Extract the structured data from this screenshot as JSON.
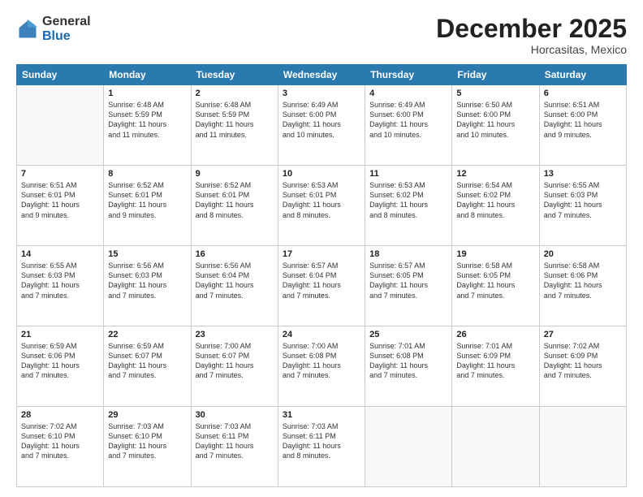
{
  "header": {
    "logo_general": "General",
    "logo_blue": "Blue",
    "month_title": "December 2025",
    "location": "Horcasitas, Mexico"
  },
  "days_of_week": [
    "Sunday",
    "Monday",
    "Tuesday",
    "Wednesday",
    "Thursday",
    "Friday",
    "Saturday"
  ],
  "weeks": [
    [
      {
        "day": "",
        "info": ""
      },
      {
        "day": "1",
        "info": "Sunrise: 6:48 AM\nSunset: 5:59 PM\nDaylight: 11 hours\nand 11 minutes."
      },
      {
        "day": "2",
        "info": "Sunrise: 6:48 AM\nSunset: 5:59 PM\nDaylight: 11 hours\nand 11 minutes."
      },
      {
        "day": "3",
        "info": "Sunrise: 6:49 AM\nSunset: 6:00 PM\nDaylight: 11 hours\nand 10 minutes."
      },
      {
        "day": "4",
        "info": "Sunrise: 6:49 AM\nSunset: 6:00 PM\nDaylight: 11 hours\nand 10 minutes."
      },
      {
        "day": "5",
        "info": "Sunrise: 6:50 AM\nSunset: 6:00 PM\nDaylight: 11 hours\nand 10 minutes."
      },
      {
        "day": "6",
        "info": "Sunrise: 6:51 AM\nSunset: 6:00 PM\nDaylight: 11 hours\nand 9 minutes."
      }
    ],
    [
      {
        "day": "7",
        "info": "Sunrise: 6:51 AM\nSunset: 6:01 PM\nDaylight: 11 hours\nand 9 minutes."
      },
      {
        "day": "8",
        "info": "Sunrise: 6:52 AM\nSunset: 6:01 PM\nDaylight: 11 hours\nand 9 minutes."
      },
      {
        "day": "9",
        "info": "Sunrise: 6:52 AM\nSunset: 6:01 PM\nDaylight: 11 hours\nand 8 minutes."
      },
      {
        "day": "10",
        "info": "Sunrise: 6:53 AM\nSunset: 6:01 PM\nDaylight: 11 hours\nand 8 minutes."
      },
      {
        "day": "11",
        "info": "Sunrise: 6:53 AM\nSunset: 6:02 PM\nDaylight: 11 hours\nand 8 minutes."
      },
      {
        "day": "12",
        "info": "Sunrise: 6:54 AM\nSunset: 6:02 PM\nDaylight: 11 hours\nand 8 minutes."
      },
      {
        "day": "13",
        "info": "Sunrise: 6:55 AM\nSunset: 6:03 PM\nDaylight: 11 hours\nand 7 minutes."
      }
    ],
    [
      {
        "day": "14",
        "info": "Sunrise: 6:55 AM\nSunset: 6:03 PM\nDaylight: 11 hours\nand 7 minutes."
      },
      {
        "day": "15",
        "info": "Sunrise: 6:56 AM\nSunset: 6:03 PM\nDaylight: 11 hours\nand 7 minutes."
      },
      {
        "day": "16",
        "info": "Sunrise: 6:56 AM\nSunset: 6:04 PM\nDaylight: 11 hours\nand 7 minutes."
      },
      {
        "day": "17",
        "info": "Sunrise: 6:57 AM\nSunset: 6:04 PM\nDaylight: 11 hours\nand 7 minutes."
      },
      {
        "day": "18",
        "info": "Sunrise: 6:57 AM\nSunset: 6:05 PM\nDaylight: 11 hours\nand 7 minutes."
      },
      {
        "day": "19",
        "info": "Sunrise: 6:58 AM\nSunset: 6:05 PM\nDaylight: 11 hours\nand 7 minutes."
      },
      {
        "day": "20",
        "info": "Sunrise: 6:58 AM\nSunset: 6:06 PM\nDaylight: 11 hours\nand 7 minutes."
      }
    ],
    [
      {
        "day": "21",
        "info": "Sunrise: 6:59 AM\nSunset: 6:06 PM\nDaylight: 11 hours\nand 7 minutes."
      },
      {
        "day": "22",
        "info": "Sunrise: 6:59 AM\nSunset: 6:07 PM\nDaylight: 11 hours\nand 7 minutes."
      },
      {
        "day": "23",
        "info": "Sunrise: 7:00 AM\nSunset: 6:07 PM\nDaylight: 11 hours\nand 7 minutes."
      },
      {
        "day": "24",
        "info": "Sunrise: 7:00 AM\nSunset: 6:08 PM\nDaylight: 11 hours\nand 7 minutes."
      },
      {
        "day": "25",
        "info": "Sunrise: 7:01 AM\nSunset: 6:08 PM\nDaylight: 11 hours\nand 7 minutes."
      },
      {
        "day": "26",
        "info": "Sunrise: 7:01 AM\nSunset: 6:09 PM\nDaylight: 11 hours\nand 7 minutes."
      },
      {
        "day": "27",
        "info": "Sunrise: 7:02 AM\nSunset: 6:09 PM\nDaylight: 11 hours\nand 7 minutes."
      }
    ],
    [
      {
        "day": "28",
        "info": "Sunrise: 7:02 AM\nSunset: 6:10 PM\nDaylight: 11 hours\nand 7 minutes."
      },
      {
        "day": "29",
        "info": "Sunrise: 7:03 AM\nSunset: 6:10 PM\nDaylight: 11 hours\nand 7 minutes."
      },
      {
        "day": "30",
        "info": "Sunrise: 7:03 AM\nSunset: 6:11 PM\nDaylight: 11 hours\nand 7 minutes."
      },
      {
        "day": "31",
        "info": "Sunrise: 7:03 AM\nSunset: 6:11 PM\nDaylight: 11 hours\nand 8 minutes."
      },
      {
        "day": "",
        "info": ""
      },
      {
        "day": "",
        "info": ""
      },
      {
        "day": "",
        "info": ""
      }
    ]
  ]
}
